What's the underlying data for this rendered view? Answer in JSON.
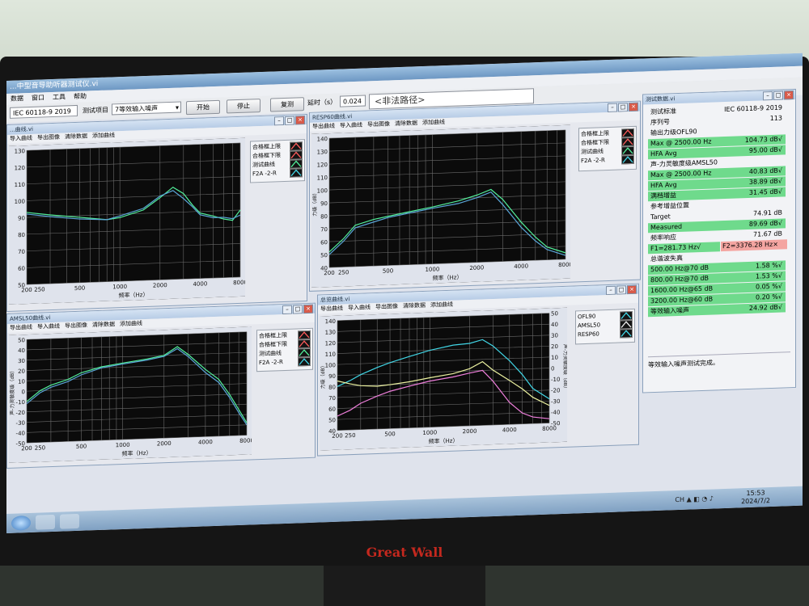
{
  "app": {
    "title": "...中型音导助听器测试仪.vi",
    "menu": [
      "数据",
      "窗口",
      "工具",
      "帮助"
    ],
    "standard": "IEC 60118-9 2019",
    "test_item_label": "测试项目",
    "test_item_value": "7等效输入噪声",
    "start_label": "开始",
    "stop_label": "停止",
    "reset_label": "复测",
    "delay_label": "延时（s）",
    "delay_value": "0.024",
    "path_value": "<非法路径>"
  },
  "colors": {
    "green_row": "#6fda8c",
    "red_row": "#f4a5a1",
    "curve_cyan": "#41d6e6",
    "curve_green": "#52ef9a",
    "curve_yellow": "#ecf2a0",
    "curve_pink": "#ef7fdc",
    "curve_blue": "#5aa5d8",
    "grid": "#6b6b6b"
  },
  "win_tl": {
    "title": "...曲线.vi",
    "menu": [
      "导入曲线",
      "导出图像",
      "清除数据",
      "添加曲线"
    ],
    "legend": [
      {
        "label": "合格框上限",
        "icon": "red-wave-icon"
      },
      {
        "label": "合格框下限",
        "icon": "red-wave-icon"
      },
      {
        "label": "测试曲线",
        "icon": "green-wave-icon"
      },
      {
        "label": "F2A -2-R",
        "icon": "cyan-wave-icon"
      }
    ]
  },
  "win_resp": {
    "title": "RESP60曲线.vi",
    "menu": [
      "导出曲线",
      "导入曲线",
      "导出图像",
      "清除数据",
      "添加曲线"
    ],
    "legend": [
      {
        "label": "合格框上限",
        "icon": "red-wave-icon"
      },
      {
        "label": "合格框下限",
        "icon": "red-wave-icon"
      },
      {
        "label": "测试曲线",
        "icon": "green-wave-icon"
      },
      {
        "label": "F2A -2-R",
        "icon": "cyan-wave-icon"
      }
    ]
  },
  "win_amsl": {
    "title": "AMSL50曲线.vi",
    "menu": [
      "导出曲线",
      "导入曲线",
      "导出图像",
      "清除数据",
      "添加曲线"
    ],
    "legend": [
      {
        "label": "合格框上限",
        "icon": "red-wave-icon"
      },
      {
        "label": "合格框下限",
        "icon": "red-wave-icon"
      },
      {
        "label": "测试曲线",
        "icon": "green-wave-icon"
      },
      {
        "label": "F2A -2-R",
        "icon": "cyan-wave-icon"
      }
    ]
  },
  "win_total": {
    "title": "总览曲线.vi",
    "menu": [
      "导出曲线",
      "导入曲线",
      "导出图像",
      "清除数据",
      "添加曲线"
    ],
    "legend": [
      {
        "label": "OFL90",
        "icon": "cyan-wave-icon"
      },
      {
        "label": "AMSL50",
        "icon": "white-wave-icon"
      },
      {
        "label": "RESP60",
        "icon": "cyan-wave-icon"
      }
    ]
  },
  "data_win": {
    "title": "测试数据.vi",
    "rows": [
      {
        "label": "测试标准",
        "value": "IEC 60118-9 2019",
        "style": "plain"
      },
      {
        "label": "序列号",
        "value": "113",
        "style": "plain"
      },
      {
        "label": "输出力级OFL90",
        "value": "",
        "style": "section"
      },
      {
        "label": "Max @ 2500.00 Hz",
        "value": "104.73 dB√",
        "style": "green"
      },
      {
        "label": "HFA Avg",
        "value": "95.00 dB√",
        "style": "green"
      },
      {
        "label": "声-力灵敏度级AMSL50",
        "value": "",
        "style": "section"
      },
      {
        "label": "Max @ 2500.00 Hz",
        "value": "40.83 dB√",
        "style": "green"
      },
      {
        "label": "HFA Avg",
        "value": "38.89 dB√",
        "style": "green"
      },
      {
        "label": "满档增益",
        "value": "31.45 dB√",
        "style": "green"
      },
      {
        "label": "参考增益位置",
        "value": "",
        "style": "section"
      },
      {
        "label": "Target",
        "value": "74.91 dB",
        "style": "plain"
      },
      {
        "label": "Measured",
        "value": "89.69 dB√",
        "style": "green"
      },
      {
        "label": "频率响应",
        "value": "71.67 dB",
        "style": "plain"
      },
      {
        "label": "F1=281.73 Hz√",
        "value": "F2=3376.28 Hz×",
        "style": "split"
      },
      {
        "label": "总谐波失真",
        "value": "",
        "style": "section"
      },
      {
        "label": "500.00 Hz@70 dB",
        "value": "1.58 %√",
        "style": "green"
      },
      {
        "label": "800.00 Hz@70 dB",
        "value": "1.53 %√",
        "style": "green"
      },
      {
        "label": "1600.00 Hz@65 dB",
        "value": "0.05 %√",
        "style": "green"
      },
      {
        "label": "3200.00 Hz@60 dB",
        "value": "0.20 %√",
        "style": "green"
      },
      {
        "label": "等效输入噪声",
        "value": "24.92 dB√",
        "style": "green"
      }
    ],
    "status": "等效输入噪声测试完成。"
  },
  "taskbar": {
    "time": "15:53",
    "date": "2024/7/2",
    "ime": "CH"
  },
  "brand": "Great Wall",
  "chart_data": [
    {
      "type": "line",
      "name_hint": "top-left",
      "x_ticks": [
        "200",
        "250",
        "500",
        "1000",
        "2000",
        "4000",
        "8000"
      ],
      "y_ticks": [
        130,
        120,
        110,
        100,
        90,
        80,
        70,
        60,
        50
      ],
      "xlabel": "频率（Hz）",
      "ylabel": "",
      "ylim": [
        50,
        130
      ],
      "xlim": [
        200,
        8000
      ],
      "x_scale": "log",
      "series": [
        {
          "color": "#52ef9a",
          "x": [
            200,
            300,
            500,
            800,
            1000,
            1500,
            2000,
            2500,
            3000,
            3500,
            4000,
            5000,
            6000,
            7000,
            8000
          ],
          "y": [
            93,
            91,
            89,
            87,
            88,
            92,
            99,
            105,
            101,
            94,
            89,
            87,
            85,
            84,
            90
          ]
        },
        {
          "color": "#5aa5d8",
          "x": [
            200,
            300,
            500,
            800,
            1000,
            1500,
            2000,
            2500,
            3000,
            3500,
            4000,
            5000,
            6000,
            7000,
            8000
          ],
          "y": [
            92,
            90,
            88,
            87,
            89,
            93,
            100,
            103,
            98,
            93,
            88,
            86,
            86,
            85,
            87
          ]
        }
      ]
    },
    {
      "type": "line",
      "name_hint": "resp60",
      "x_ticks": [
        "200",
        "250",
        "500",
        "1000",
        "2000",
        "4000",
        "8000"
      ],
      "y_ticks": [
        140,
        130,
        120,
        110,
        100,
        90,
        80,
        70,
        60,
        50,
        40
      ],
      "xlabel": "频率（Hz）",
      "ylabel": "力级（dB）",
      "ylim": [
        40,
        140
      ],
      "xlim": [
        200,
        8000
      ],
      "x_scale": "log",
      "series": [
        {
          "color": "#52ef9a",
          "x": [
            200,
            250,
            300,
            400,
            500,
            700,
            1000,
            1500,
            2000,
            2500,
            3000,
            4000,
            5000,
            6000,
            8000
          ],
          "y": [
            52,
            62,
            72,
            76,
            78,
            81,
            84,
            88,
            92,
            96,
            88,
            70,
            58,
            50,
            45
          ]
        },
        {
          "color": "#5aa5d8",
          "x": [
            200,
            250,
            300,
            400,
            500,
            700,
            1000,
            1500,
            2000,
            2500,
            3000,
            4000,
            5000,
            6000,
            8000
          ],
          "y": [
            50,
            60,
            70,
            74,
            77,
            80,
            83,
            86,
            90,
            94,
            84,
            66,
            55,
            48,
            43
          ]
        }
      ]
    },
    {
      "type": "line",
      "name_hint": "amsl50",
      "x_ticks": [
        "200",
        "250",
        "500",
        "1000",
        "2000",
        "4000",
        "8000"
      ],
      "y_ticks": [
        50,
        40,
        30,
        20,
        10,
        0,
        -10,
        -20,
        -30,
        -40,
        -50
      ],
      "xlabel": "频率（Hz）",
      "ylabel": "声-力灵敏度级（dB）",
      "ylim": [
        -50,
        50
      ],
      "xlim": [
        200,
        8000
      ],
      "x_scale": "log",
      "series": [
        {
          "color": "#52ef9a",
          "x": [
            200,
            250,
            300,
            400,
            500,
            700,
            1000,
            1500,
            2000,
            2500,
            3000,
            4000,
            5000,
            6000,
            7000,
            8000
          ],
          "y": [
            -10,
            0,
            5,
            10,
            16,
            21,
            24,
            27,
            30,
            38,
            30,
            15,
            5,
            -10,
            -25,
            -38
          ]
        },
        {
          "color": "#5aa5d8",
          "x": [
            200,
            250,
            300,
            400,
            500,
            700,
            1000,
            1500,
            2000,
            2500,
            3000,
            4000,
            5000,
            6000,
            7000,
            8000
          ],
          "y": [
            -12,
            -2,
            3,
            8,
            14,
            20,
            23,
            26,
            29,
            36,
            28,
            12,
            2,
            -13,
            -28,
            -40
          ]
        }
      ]
    },
    {
      "type": "line",
      "name_hint": "total",
      "x_ticks": [
        "200",
        "250",
        "500",
        "1000",
        "2000",
        "4000",
        "8000"
      ],
      "y_ticks": [
        140,
        130,
        120,
        110,
        100,
        90,
        80,
        70,
        60,
        50,
        40
      ],
      "y2_ticks": [
        50,
        40,
        30,
        20,
        10,
        0,
        -10,
        -20,
        -30,
        -40,
        -50
      ],
      "xlabel": "频率（Hz）",
      "ylabel": "力级（dB）",
      "y2label": "声-力灵敏度级（dB）",
      "ylim": [
        40,
        140
      ],
      "xlim": [
        200,
        8000
      ],
      "x_scale": "log",
      "series": [
        {
          "name": "OFL90",
          "color": "#41d6e6",
          "x": [
            200,
            250,
            300,
            400,
            500,
            700,
            1000,
            1500,
            2000,
            2500,
            3000,
            4000,
            5000,
            6000,
            8000
          ],
          "y": [
            80,
            85,
            90,
            96,
            100,
            105,
            110,
            114,
            115,
            118,
            112,
            98,
            85,
            72,
            62
          ]
        },
        {
          "name": "AMSL50",
          "color": "#ecf2a0",
          "x": [
            200,
            250,
            300,
            400,
            500,
            700,
            1000,
            1500,
            2000,
            2500,
            3000,
            4000,
            5000,
            6000,
            8000
          ],
          "y": [
            85,
            82,
            80,
            79,
            80,
            82,
            85,
            88,
            92,
            98,
            90,
            80,
            72,
            64,
            56
          ]
        },
        {
          "name": "RESP60",
          "color": "#ef7fdc",
          "x": [
            200,
            250,
            300,
            400,
            500,
            700,
            1000,
            1500,
            2000,
            2500,
            3000,
            4000,
            5000,
            6000,
            8000
          ],
          "y": [
            53,
            58,
            64,
            70,
            74,
            78,
            82,
            85,
            88,
            90,
            80,
            60,
            50,
            46,
            44
          ]
        }
      ]
    }
  ]
}
